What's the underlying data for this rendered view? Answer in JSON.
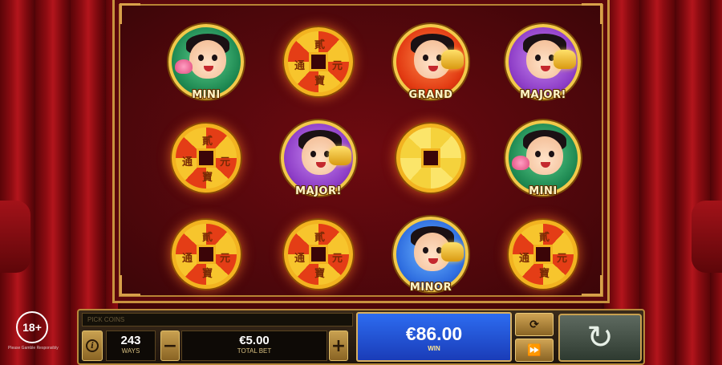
{
  "reels": [
    [
      {
        "type": "character",
        "variant": "mini",
        "label": "MINI"
      },
      {
        "type": "coin",
        "variant": "red",
        "glyphs": [
          "貳",
          "元",
          "寶",
          "通"
        ]
      },
      {
        "type": "character",
        "variant": "grand",
        "label": "GRAND"
      },
      {
        "type": "character",
        "variant": "major",
        "label": "MAJOR!"
      }
    ],
    [
      {
        "type": "coin",
        "variant": "red",
        "glyphs": [
          "貳",
          "元",
          "寶",
          "通"
        ]
      },
      {
        "type": "character",
        "variant": "major",
        "label": "MAJOR!"
      },
      {
        "type": "coin",
        "variant": "gold",
        "glyphs": [
          "",
          "",
          "",
          ""
        ]
      },
      {
        "type": "character",
        "variant": "mini",
        "label": "MINI"
      }
    ],
    [
      {
        "type": "coin",
        "variant": "red",
        "glyphs": [
          "貳",
          "元",
          "寶",
          "通"
        ]
      },
      {
        "type": "coin",
        "variant": "red",
        "glyphs": [
          "貳",
          "元",
          "寶",
          "通"
        ]
      },
      {
        "type": "character",
        "variant": "minor",
        "label": "MINOR"
      },
      {
        "type": "coin",
        "variant": "red",
        "glyphs": [
          "貳",
          "元",
          "寶",
          "通"
        ]
      }
    ]
  ],
  "age_badge": "18+",
  "gamble_note": "Please Gamble Responsibly",
  "controls": {
    "pick_coins": "PICK COINS",
    "info_icon": "i",
    "ways_value": "243",
    "ways_label": "WAYS",
    "minus": "−",
    "plus": "+",
    "total_bet_value": "€5.00",
    "total_bet_label": "TOTAL BET",
    "win_value": "€86.00",
    "win_label": "WIN",
    "autoplay_icon": "⟳",
    "fast_icon": "⏩",
    "spin_icon": "↻"
  },
  "colors": {
    "win_panel": "#2d6cf0",
    "frame_gold": "#c8923e",
    "background_red": "#4a0609"
  }
}
